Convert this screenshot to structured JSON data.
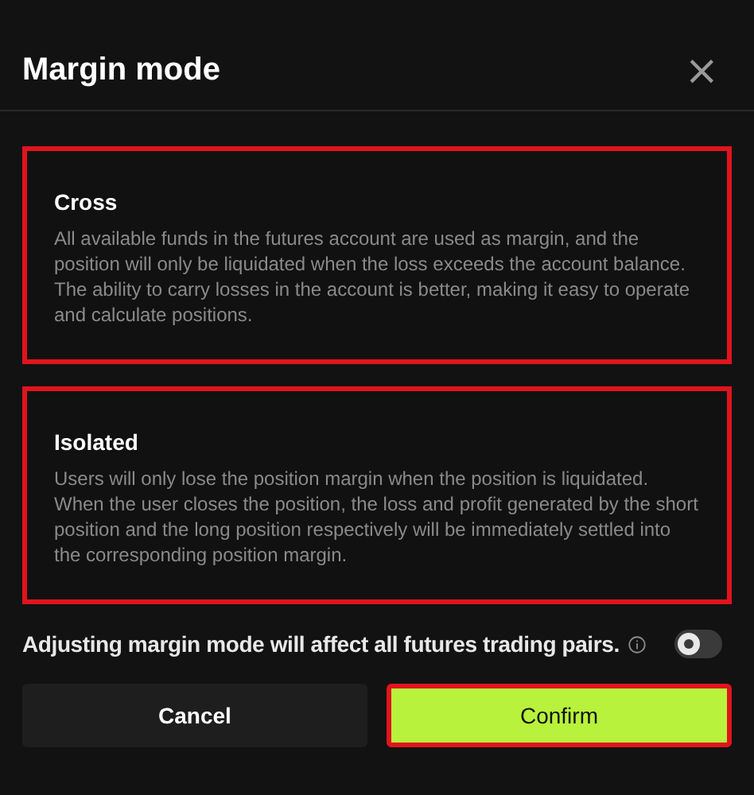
{
  "dialog": {
    "title": "Margin mode",
    "close_icon": "×"
  },
  "options": [
    {
      "title": "Cross",
      "description": "All available funds in the futures account are used as margin, and the position will only be liquidated when the loss exceeds the account balance. The ability to carry losses in the account is better, making it easy to operate and calculate positions.",
      "highlighted": true
    },
    {
      "title": "Isolated",
      "description": "Users will only lose the position margin when the position is liquidated. When the user closes the position, the loss and profit generated by the short position and the long position respectively will be immediately settled into the corresponding position margin.",
      "highlighted": true
    }
  ],
  "notice": {
    "text": "Adjusting margin mode will affect all futures trading pairs.",
    "toggle_on": false
  },
  "buttons": [
    {
      "label": "Cancel",
      "kind": "secondary",
      "highlighted": false
    },
    {
      "label": "Confirm",
      "kind": "primary",
      "highlighted": true
    }
  ]
}
